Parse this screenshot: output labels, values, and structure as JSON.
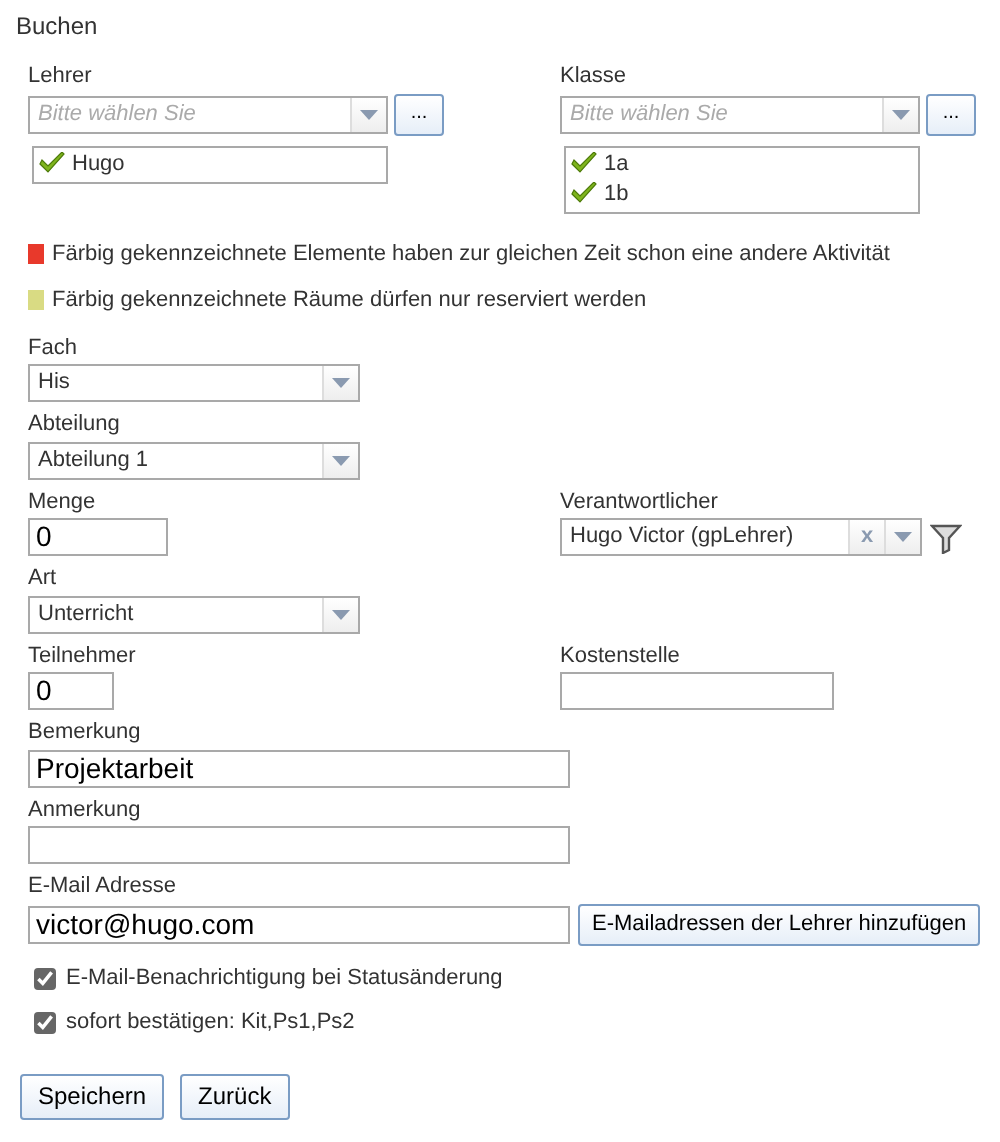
{
  "title": "Buchen",
  "lehrer": {
    "label": "Lehrer",
    "placeholder": "Bitte wählen Sie",
    "browse": "...",
    "items": [
      {
        "label": "Hugo"
      }
    ]
  },
  "klasse": {
    "label": "Klasse",
    "placeholder": "Bitte wählen Sie",
    "browse": "...",
    "items": [
      {
        "label": "1a"
      },
      {
        "label": "1b"
      }
    ]
  },
  "legend": [
    {
      "color": "#e8392b",
      "text": "Färbig gekennzeichnete Elemente haben zur gleichen Zeit schon eine andere Aktivität"
    },
    {
      "color": "#d9db83",
      "text": "Färbig gekennzeichnete Räume dürfen nur reserviert werden"
    }
  ],
  "fach": {
    "label": "Fach",
    "value": "His"
  },
  "abteilung": {
    "label": "Abteilung",
    "value": "Abteilung 1"
  },
  "menge": {
    "label": "Menge",
    "value": "0"
  },
  "verantwortlicher": {
    "label": "Verantwortlicher",
    "value": "Hugo Victor (gpLehrer)",
    "clear": "x"
  },
  "art": {
    "label": "Art",
    "value": "Unterricht"
  },
  "teilnehmer": {
    "label": "Teilnehmer",
    "value": "0"
  },
  "kostenstelle": {
    "label": "Kostenstelle"
  },
  "bemerkung": {
    "label": "Bemerkung",
    "value": "Projektarbeit"
  },
  "anmerkung": {
    "label": "Anmerkung"
  },
  "email": {
    "label": "E-Mail Adresse",
    "value": "victor@hugo.com",
    "button": "E-Mailadressen der Lehrer hinzufügen"
  },
  "options": [
    {
      "label": "E-Mail-Benachrichtigung bei Statusänderung",
      "checked": true
    },
    {
      "label": "sofort bestätigen: Kit,Ps1,Ps2",
      "checked": true
    }
  ],
  "buttons": [
    "Speichern",
    "Zurück"
  ]
}
